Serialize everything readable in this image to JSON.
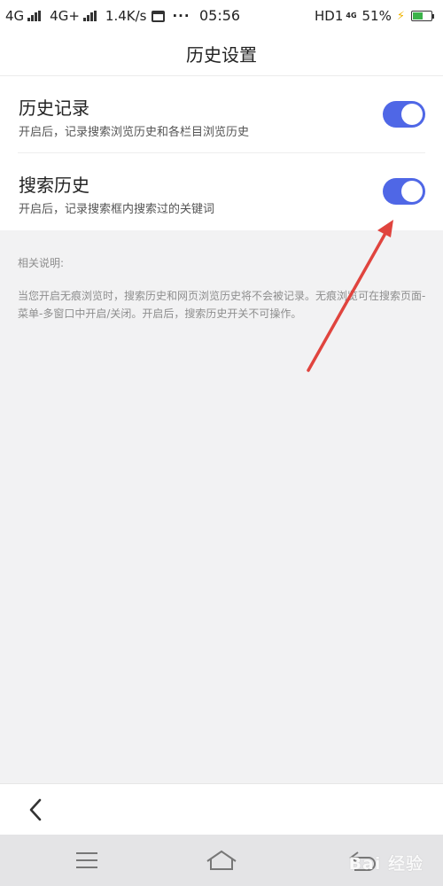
{
  "status_bar": {
    "network1": "4G",
    "network2": "4G+",
    "speed": "1.4K/s",
    "dots": "···",
    "time": "05:56",
    "hd": "HD1",
    "net_small": "4G",
    "battery": "51%"
  },
  "header": {
    "title": "历史设置"
  },
  "settings": [
    {
      "title": "历史记录",
      "desc": "开启后，记录搜索浏览历史和各栏目浏览历史",
      "enabled": true
    },
    {
      "title": "搜索历史",
      "desc": "开启后，记录搜索框内搜索过的关键词",
      "enabled": true
    }
  ],
  "notes": {
    "heading": "相关说明:",
    "text": "当您开启无痕浏览时，搜索历史和网页浏览历史将不会被记录。无痕浏览可在搜索页面-菜单-多窗口中开启/关闭。开启后，搜索历史开关不可操作。"
  },
  "colors": {
    "toggle_on": "#4f67e6",
    "arrow": "#e0443e",
    "battery": "#3bb34a"
  },
  "watermark": "Bai 经验"
}
